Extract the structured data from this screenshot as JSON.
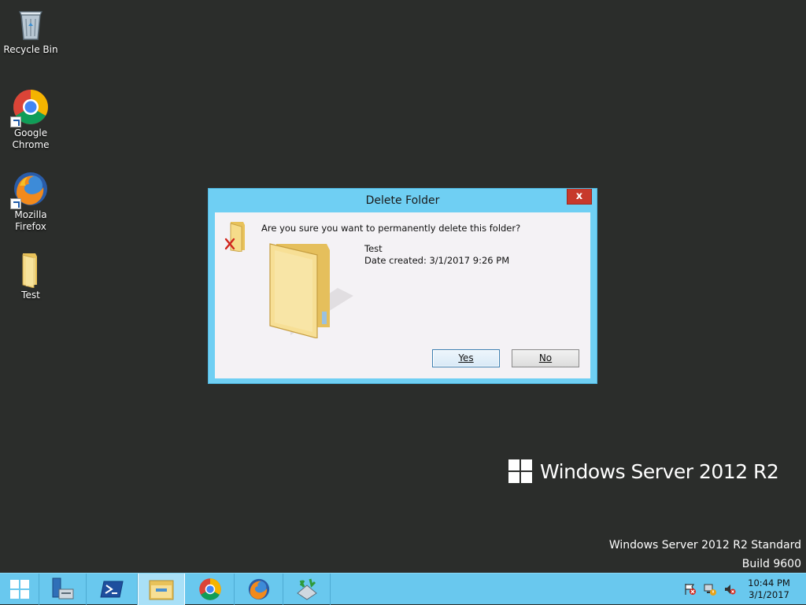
{
  "desktop": {
    "icons": [
      {
        "label": "Recycle Bin"
      },
      {
        "label_line1": "Google",
        "label_line2": "Chrome"
      },
      {
        "label_line1": "Mozilla",
        "label_line2": "Firefox"
      },
      {
        "label": "Test"
      }
    ]
  },
  "branding": {
    "logo_text": "Windows Server 2012 R2",
    "edition": "Windows Server 2012 R2 Standard",
    "build": "Build 9600"
  },
  "dialog": {
    "title": "Delete Folder",
    "close_label": "x",
    "message": "Are you sure you want to permanently delete this folder?",
    "folder_name": "Test",
    "date_created": "Date created: 3/1/2017 9:26 PM",
    "yes_label": "Yes",
    "no_label": "No"
  },
  "taskbar": {
    "buttons": [
      "start-icon",
      "server-manager-icon",
      "powershell-icon",
      "file-explorer-icon",
      "chrome-icon",
      "firefox-icon",
      "network-transfer-icon"
    ],
    "clock_time": "10:44 PM",
    "clock_date": "3/1/2017"
  },
  "colors": {
    "desktop_bg": "#2b2d2b",
    "dialog_frame": "#6fcff3",
    "taskbar_bg": "#69c8ee",
    "close_red": "#c7392b"
  }
}
